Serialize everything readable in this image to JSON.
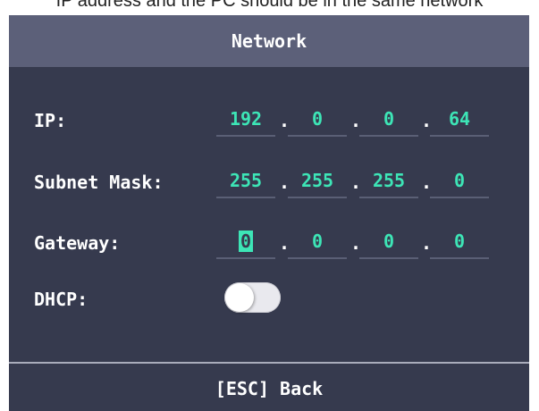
{
  "caption": "IP address and the PC should be in the same network",
  "title": "Network",
  "fields": {
    "ip": {
      "label": "IP:",
      "octets": [
        "192",
        "0",
        "0",
        "64"
      ]
    },
    "subnet": {
      "label": "Subnet Mask:",
      "octets": [
        "255",
        "255",
        "255",
        "0"
      ]
    },
    "gateway": {
      "label": "Gateway:",
      "octets": [
        "0",
        "0",
        "0",
        "0"
      ]
    },
    "dhcp": {
      "label": "DHCP:",
      "enabled": false
    }
  },
  "separator": ".",
  "footer": "[ESC] Back",
  "colors": {
    "title_bar": "#5c6079",
    "background": "#363a4e",
    "value_text": "#3de5b6",
    "label_text": "#ffffff",
    "cursor": "#3de5b6"
  }
}
